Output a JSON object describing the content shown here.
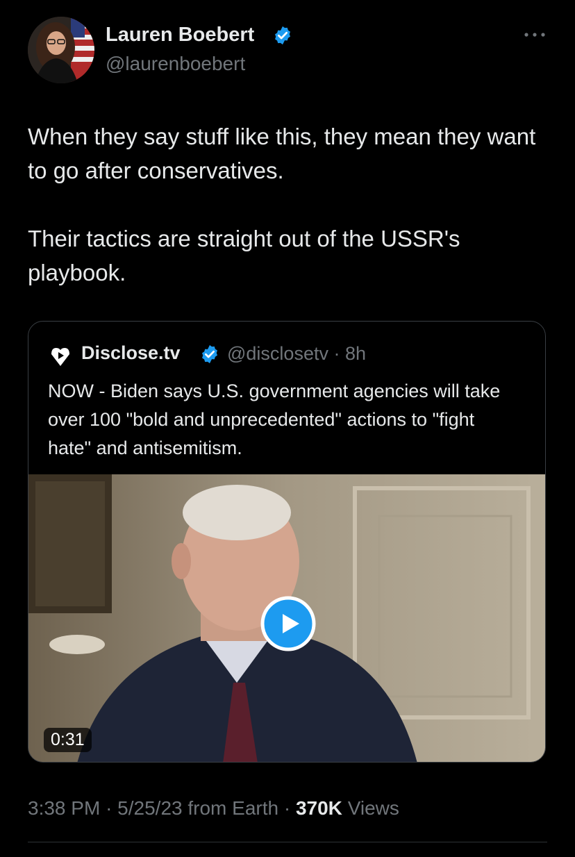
{
  "author": {
    "display_name": "Lauren Boebert",
    "handle": "@laurenboebert",
    "verified": true,
    "verified_color": "#1d9bf0"
  },
  "more_icon": "more-horizontal-icon",
  "tweet": {
    "paragraphs": [
      "When they say stuff like this, they mean they want to go after conservatives.",
      "Their tactics are straight out of the USSR's playbook."
    ]
  },
  "quoted_tweet": {
    "display_name": "Disclose.tv",
    "handle": "@disclosetv",
    "separator": "·",
    "age": "8h",
    "text": "NOW - Biden says U.S. government agencies will take over 100 \"bold and unprecedented\" actions to \"fight hate\" and antisemitism.",
    "media": {
      "type": "video",
      "duration": "0:31",
      "play_icon": "play-icon"
    }
  },
  "footer": {
    "time": "3:38 PM",
    "date": "5/25/23",
    "source": "from Earth",
    "views_count": "370K",
    "views_label": "Views"
  },
  "colors": {
    "background": "#000000",
    "text_primary": "#e7e9ea",
    "text_secondary": "#71767b",
    "accent": "#1d9bf0",
    "border": "#3a3f44"
  }
}
